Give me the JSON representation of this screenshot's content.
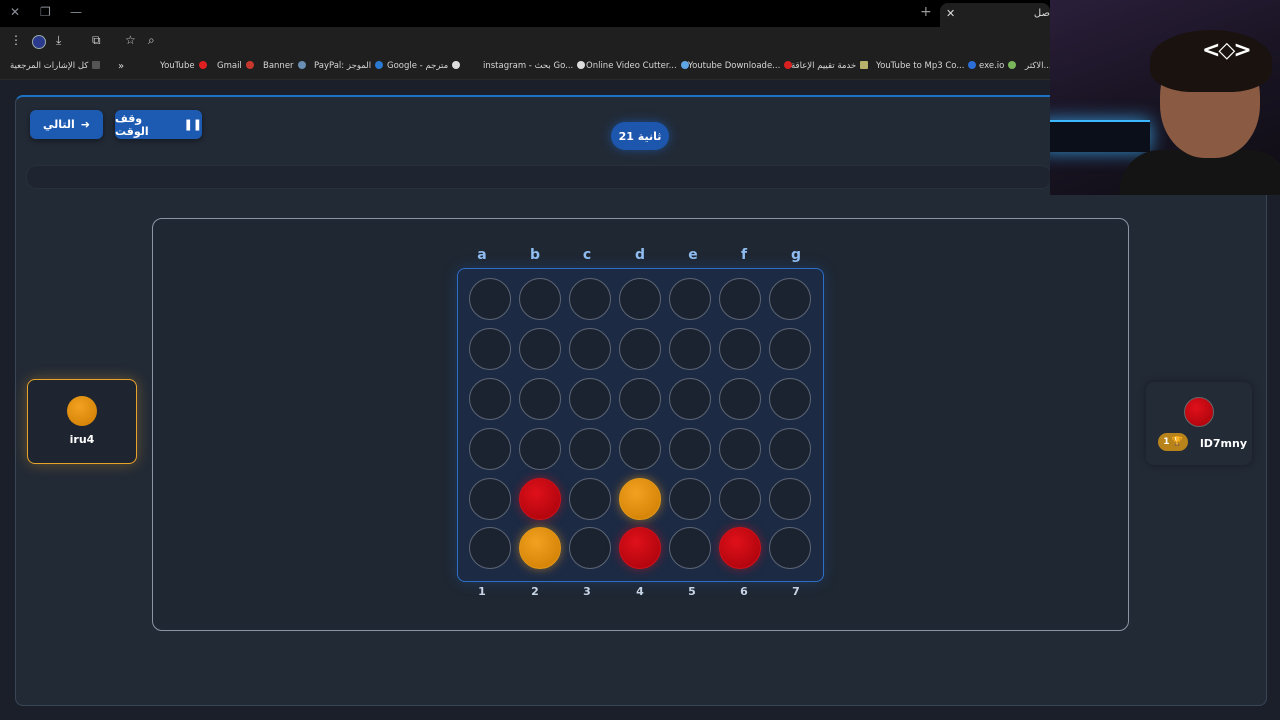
{
  "browser": {
    "active_tab_title": "ﺻﻞ",
    "bookmarks": [
      {
        "label": "كل الإشارات المرجعية",
        "icon": "folder-icon"
      },
      {
        "label": "YouTube",
        "icon": "youtube-icon"
      },
      {
        "label": "Gmail",
        "icon": "gmail-icon"
      },
      {
        "label": "Banner",
        "icon": "banner-icon"
      },
      {
        "label": "PayPal: الموجز",
        "icon": "paypal-icon"
      },
      {
        "label": "Google - مترجم",
        "icon": "translate-icon"
      },
      {
        "label": "instagram - بحث Go...",
        "icon": "google-icon"
      },
      {
        "label": "Online Video Cutter...",
        "icon": "video-cutter-icon"
      },
      {
        "label": "Youtube Downloade...",
        "icon": "download-icon"
      },
      {
        "label": "خدمة تقييم الإعاقة",
        "icon": "service-icon"
      },
      {
        "label": "YouTube to Mp3 Co...",
        "icon": "mp3-icon"
      },
      {
        "label": "exe.io",
        "icon": "exeio-icon"
      },
      {
        "label": "الاكثر...",
        "icon": "more-icon"
      }
    ]
  },
  "controls": {
    "next_label": "التالي",
    "pause_label": "وقف الوقت",
    "timer_text": "21 ثانية"
  },
  "board": {
    "columns": [
      "a",
      "b",
      "c",
      "d",
      "e",
      "f",
      "g"
    ],
    "row_numbers": [
      "1",
      "2",
      "3",
      "4",
      "5",
      "6",
      "7"
    ],
    "grid": [
      [
        "",
        "",
        "",
        "",
        "",
        "",
        ""
      ],
      [
        "",
        "",
        "",
        "",
        "",
        "",
        ""
      ],
      [
        "",
        "",
        "",
        "",
        "",
        "",
        ""
      ],
      [
        "",
        "",
        "",
        "",
        "",
        "",
        ""
      ],
      [
        "",
        "red",
        "",
        "orange",
        "",
        "",
        ""
      ],
      [
        "",
        "orange",
        "",
        "red",
        "",
        "red",
        ""
      ]
    ]
  },
  "players": {
    "left": {
      "name": "iru4",
      "color": "#f0a020"
    },
    "right": {
      "name": "lD7mny",
      "color": "#d10a14",
      "wins": "1"
    }
  },
  "colors": {
    "accent": "#1d5bb3",
    "orange_disc": "#f0a020",
    "red_disc": "#d10a14",
    "background": "#1a1f2a"
  }
}
